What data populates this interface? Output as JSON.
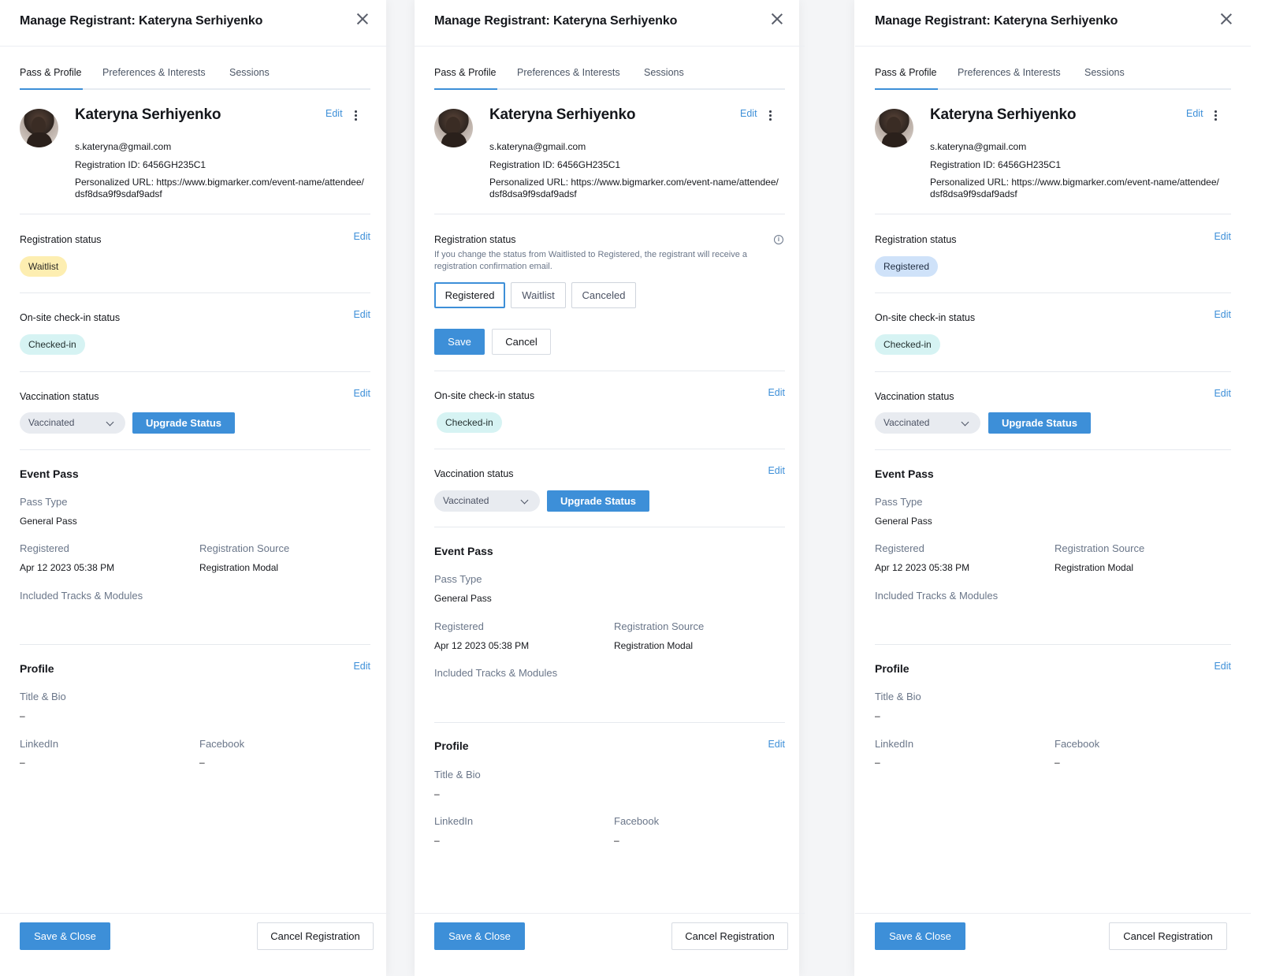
{
  "header": {
    "title": "Manage Registrant: Kateryna Serhiyenko"
  },
  "tabs": [
    "Pass & Profile",
    "Preferences & Interests",
    "Sessions"
  ],
  "profile": {
    "name": "Kateryna Serhiyenko",
    "email": "s.kateryna@gmail.com",
    "registration_id": "Registration ID: 6456GH235C1",
    "url_line1": "Personalized URL: https://www.bigmarker.com/event-name/attendee/",
    "url_line2": "dsf8dsa9f9sdaf9adsf",
    "edit": "Edit"
  },
  "registration": {
    "label": "Registration status",
    "edit": "Edit",
    "help": "If you change the status from Waitlisted to Registered, the registrant will receive a registration confirmation email.",
    "options": [
      "Registered",
      "Waitlist",
      "Canceled"
    ],
    "save": "Save",
    "cancel": "Cancel"
  },
  "checkin": {
    "label": "On-site check-in status",
    "edit": "Edit",
    "value": "Checked-in"
  },
  "vaccination": {
    "label": "Vaccination status",
    "edit": "Edit",
    "value": "Vaccinated",
    "upgrade": "Upgrade Status"
  },
  "event_pass": {
    "title": "Event Pass",
    "pass_type_label": "Pass Type",
    "pass_type": "General Pass",
    "registered_label": "Registered",
    "registered": "Apr 12 2023 05:38 PM",
    "source_label": "Registration Source",
    "source": "Registration Modal",
    "tracks_label": "Included Tracks & Modules"
  },
  "profile_section": {
    "title": "Profile",
    "edit": "Edit",
    "title_bio_label": "Title & Bio",
    "title_bio": "–",
    "linkedin_label": "LinkedIn",
    "linkedin": "–",
    "facebook_label": "Facebook",
    "facebook": "–"
  },
  "footer": {
    "save_close": "Save & Close",
    "cancel_registration": "Cancel Registration"
  },
  "panels": [
    {
      "state": "view",
      "registration_status": "Waitlist"
    },
    {
      "state": "editing",
      "registration_status": "Registered"
    },
    {
      "state": "view",
      "registration_status": "Registered"
    }
  ],
  "colors": {
    "accent": "#3d8fd8",
    "waitlist_badge": "#fdeeb1",
    "checked_badge": "#d6f3f3",
    "registered_badge": "#cfe2f9"
  }
}
